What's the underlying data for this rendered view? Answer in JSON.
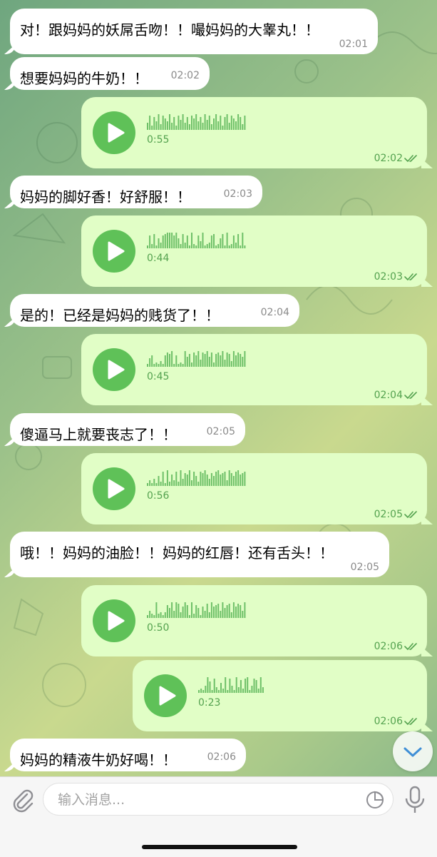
{
  "theme": {
    "incoming_bg": "#ffffff",
    "outgoing_bg": "#e1fec6",
    "play_button": "#5fc158",
    "accent_text": "#54a24f"
  },
  "messages": [
    {
      "type": "text",
      "dir": "in",
      "text": "对！跟妈妈的妖屌舌吻！！嘬妈妈的大睾丸！！",
      "time": "02:01"
    },
    {
      "type": "text",
      "dir": "in",
      "text": "想要妈妈的牛奶！！",
      "time": "02:02"
    },
    {
      "type": "voice",
      "dir": "out",
      "duration": "0:55",
      "time": "02:02",
      "read": true
    },
    {
      "type": "text",
      "dir": "in",
      "text": "妈妈的脚好香！好舒服！！",
      "time": "02:03"
    },
    {
      "type": "voice",
      "dir": "out",
      "duration": "0:44",
      "time": "02:03",
      "read": true
    },
    {
      "type": "text",
      "dir": "in",
      "text": "是的！已经是妈妈的贱货了！！",
      "time": "02:04"
    },
    {
      "type": "voice",
      "dir": "out",
      "duration": "0:45",
      "time": "02:04",
      "read": true
    },
    {
      "type": "text",
      "dir": "in",
      "text": "傻逼马上就要丧志了！！",
      "time": "02:05"
    },
    {
      "type": "voice",
      "dir": "out",
      "duration": "0:56",
      "time": "02:05",
      "read": true
    },
    {
      "type": "text",
      "dir": "in",
      "text": "哦！！妈妈的油脸！！妈妈的红唇！还有舌头！！",
      "time": "02:05"
    },
    {
      "type": "voice",
      "dir": "out",
      "duration": "0:50",
      "time": "02:06",
      "read": true
    },
    {
      "type": "voice",
      "dir": "out",
      "duration": "0:23",
      "time": "02:06",
      "read": true
    },
    {
      "type": "text",
      "dir": "in",
      "text": "妈妈的精液牛奶好喝！！",
      "time": "02:06"
    }
  ],
  "composer": {
    "placeholder": "输入消息..."
  },
  "icons": {
    "attach": "paperclip-icon",
    "sticker": "sticker-icon",
    "mic": "microphone-icon",
    "scroll": "chevron-down-icon",
    "play": "play-icon",
    "read": "double-check-icon"
  }
}
